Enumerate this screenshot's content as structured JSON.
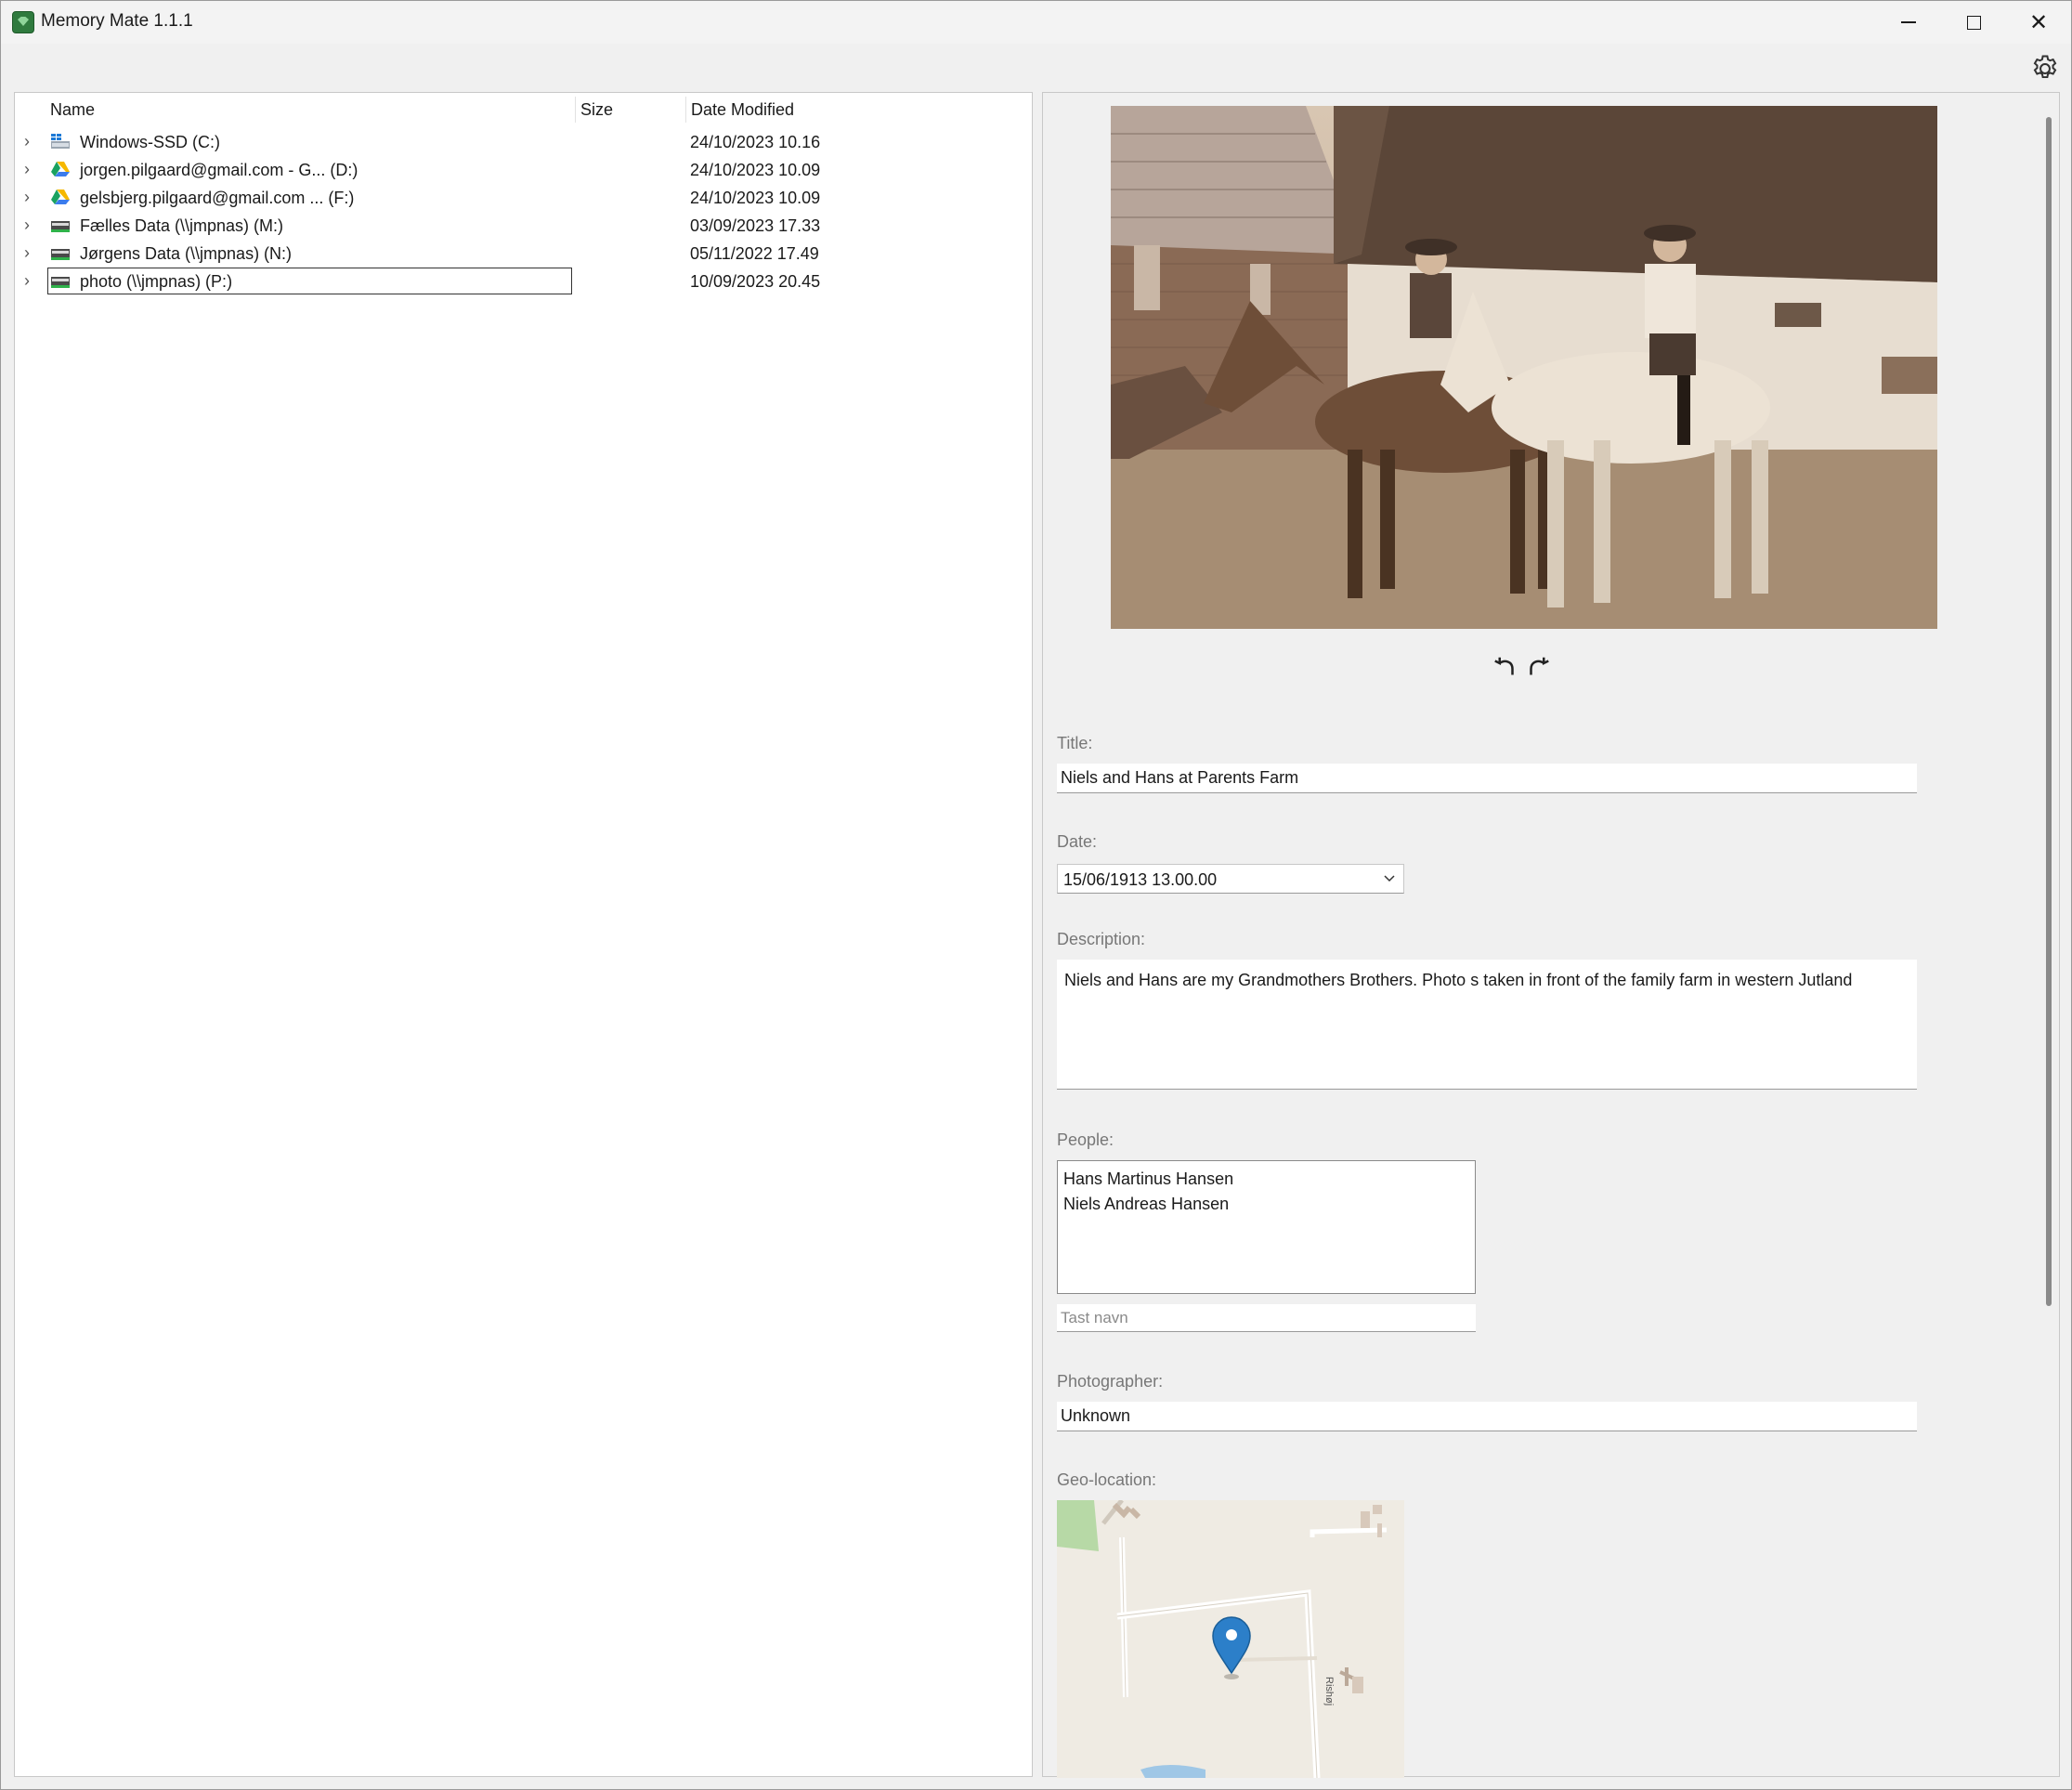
{
  "window": {
    "title": "Memory Mate 1.1.1",
    "minimize_icon": "minimize-icon",
    "maximize_icon": "maximize-icon",
    "close_icon": "close-icon",
    "close_glyph": "✕"
  },
  "toolbar": {
    "settings_icon": "gear-icon"
  },
  "tree": {
    "columns": {
      "name": "Name",
      "size": "Size",
      "date": "Date Modified"
    },
    "rows": [
      {
        "name": "Windows-SSD (C:)",
        "date": "24/10/2023 10.16",
        "icon": "windows-drive-icon"
      },
      {
        "name": "jorgen.pilgaard@gmail.com - G... (D:)",
        "date": "24/10/2023 10.09",
        "icon": "google-drive-icon"
      },
      {
        "name": "gelsbjerg.pilgaard@gmail.com ... (F:)",
        "date": "24/10/2023 10.09",
        "icon": "google-drive-icon"
      },
      {
        "name": "Fælles Data (\\\\jmpnas) (M:)",
        "date": "03/09/2023 17.33",
        "icon": "network-drive-icon"
      },
      {
        "name": "Jørgens Data (\\\\jmpnas) (N:)",
        "date": "05/11/2022 17.49",
        "icon": "network-drive-icon"
      },
      {
        "name": "photo (\\\\jmpnas) (P:)",
        "date": "10/09/2023 20.45",
        "icon": "network-drive-icon"
      }
    ],
    "chevron": "›"
  },
  "details": {
    "rotate_left_icon": "rotate-left-icon",
    "rotate_right_icon": "rotate-right-icon",
    "title_label": "Title:",
    "title_value": "Niels and Hans at Parents Farm",
    "date_label": "Date:",
    "date_value": "15/06/1913 13.00.00",
    "description_label": "Description:",
    "description_value": "Niels and Hans are my Grandmothers Brothers. Photo s taken in front of the family farm in western Jutland",
    "people_label": "People:",
    "people": [
      "Hans Martinus Hansen",
      "Niels Andreas Hansen"
    ],
    "people_placeholder": "Tast navn",
    "photographer_label": "Photographer:",
    "photographer_value": "Unknown",
    "geo_label": "Geo-location:",
    "map_street_label": "Rishøj"
  }
}
